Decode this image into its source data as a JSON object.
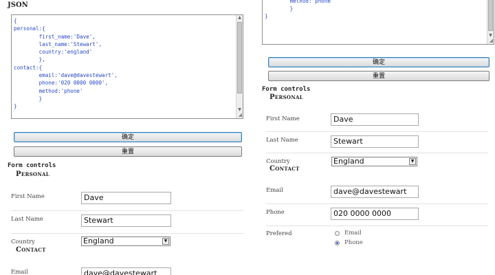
{
  "json_panel": {
    "title": "JSON",
    "text": "{\npersonal:{\n        first_name:'Dave',\n        last_name:'Stewart',\n        country:'england'\n        },\ncontact:{\n        email:'dave@davestewart',\n        phone:'020 0000 0000',\n        method:'phone'\n        }\n}",
    "scrolled_text": "contact:{\n        email:'dave@davestewart',\n        phone:'020 0000 0000',\n        method:'phone'\n        }\n}"
  },
  "buttons": {
    "confirm": "确定",
    "reset": "重置"
  },
  "form": {
    "title": "Form controls",
    "personal": {
      "legend": "Personal",
      "first_name_label": "First Name",
      "first_name_value": "Dave",
      "last_name_label": "Last Name",
      "last_name_value": "Stewart",
      "country_label": "Country",
      "country_value": "England"
    },
    "contact": {
      "legend": "Contact",
      "email_label": "Email",
      "email_value": "dave@davestewart",
      "phone_label": "Phone",
      "phone_value": "020 0000 0000",
      "prefered_label": "Prefered",
      "options": [
        "Email",
        "Phone"
      ],
      "selected": "Phone"
    }
  },
  "icons": {
    "scroll_up": "chevron-up-icon",
    "scroll_down": "chevron-down-icon",
    "dropdown": "chevron-down-icon",
    "resize": "resize-grip-icon"
  }
}
